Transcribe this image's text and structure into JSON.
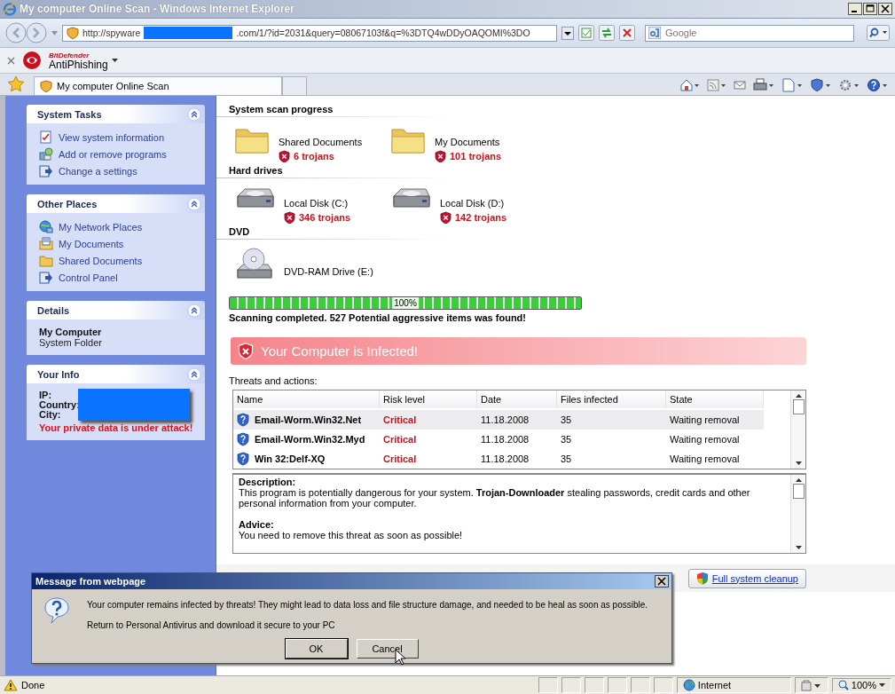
{
  "window": {
    "title": "My computer Online Scan - Windows Internet Explorer"
  },
  "address_bar": {
    "url_start": "http://spyware",
    "url_end": ".com/1/?id=2031&query=08067103f&q=%3DTQ4wDDyOAQOMI%3DO",
    "search_placeholder": "Google"
  },
  "links_toolbar": {
    "brand": "BitDefender",
    "name": "AntiPhishing"
  },
  "tabs": [
    {
      "label": "My computer Online Scan",
      "selected": true
    }
  ],
  "sidebar": [
    {
      "kind": "links",
      "title": "System Tasks",
      "items": [
        {
          "kind": "checklist",
          "label": "View system information"
        },
        {
          "kind": "programs",
          "label": "Add or remove programs"
        },
        {
          "kind": "panel",
          "label": "Change a settings"
        }
      ]
    },
    {
      "kind": "links",
      "title": "Other Places",
      "items": [
        {
          "kind": "network",
          "label": "My Network Places"
        },
        {
          "kind": "documents",
          "label": "My Documents"
        },
        {
          "kind": "folder",
          "label": "Shared Documents"
        },
        {
          "kind": "panel",
          "label": "Control Panel"
        }
      ]
    },
    {
      "kind": "details",
      "title": "Details",
      "name": "My Computer",
      "subtitle": "System Folder"
    },
    {
      "kind": "info",
      "title": "Your Info",
      "fields": [
        "IP:",
        "Country:",
        "City:"
      ],
      "warning": "Your private data is under attack!"
    }
  ],
  "scan": {
    "sections": [
      {
        "title": "System scan progress",
        "items": [
          {
            "kind": "folder",
            "name": "Shared Documents",
            "threats": "6 trojans"
          },
          {
            "kind": "folder",
            "name": "My Documents",
            "threats": "101 trojans"
          }
        ]
      },
      {
        "title": "Hard drives",
        "items": [
          {
            "kind": "disk",
            "name": "Local Disk (C:)",
            "threats": "346 trojans"
          },
          {
            "kind": "disk",
            "name": "Local Disk (D:)",
            "threats": "142 trojans"
          }
        ]
      },
      {
        "title": "DVD",
        "items": [
          {
            "kind": "dvd",
            "name": "DVD-RAM Drive (E:)"
          }
        ]
      }
    ],
    "progress": {
      "level": 1,
      "label": "100%"
    },
    "summary": "Scanning completed. 527 Potential aggressive items was found!",
    "alert": "Your Computer is Infected!",
    "threats_label": "Threats and actions:",
    "table": {
      "columns": [
        "Name",
        "Risk level",
        "Date",
        "Files infected",
        "State"
      ],
      "rows": [
        {
          "selected": true,
          "cells": [
            "Email-Worm.Win32.Net",
            "Critical",
            "11.18.2008",
            "35",
            "Waiting removal"
          ]
        },
        {
          "selected": false,
          "cells": [
            "Email-Worm.Win32.Myd",
            "Critical",
            "11.18.2008",
            "35",
            "Waiting removal"
          ]
        },
        {
          "selected": false,
          "cells": [
            "Win 32:Delf-XQ",
            "Critical",
            "11.18.2008",
            "35",
            "Waiting removal"
          ]
        }
      ]
    },
    "description": {
      "heading": "Description:",
      "text": "This program is potentially dangerous for your system. **Trojan-Downloader** stealing passwords, credit cards and other personal information from your computer.",
      "advice_heading": "Advice:",
      "advice": "You need to remove this threat as soon as possible!"
    },
    "cleanup_button": "Full system cleanup"
  },
  "dialog": {
    "title": "Message from webpage",
    "message": "Your computer remains infected by threats! They might lead to data loss and file structure damage, and needed to be heal as soon as possible.",
    "note": "Return to Personal Antivirus and download it secure to your PC",
    "buttons": [
      {
        "label": "OK",
        "default": true
      },
      {
        "label": "Cancel",
        "default": false
      }
    ]
  },
  "status_bar": {
    "text": "Done",
    "zone": "Internet",
    "zoom": "100%"
  }
}
